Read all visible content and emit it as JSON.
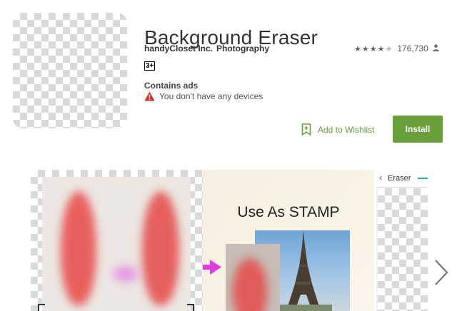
{
  "app": {
    "title": "Background Eraser",
    "developer": "handyCloset Inc.",
    "category": "Photography",
    "content_rating": "3+",
    "rating_stars": 4.5,
    "rating_count": "176,730",
    "contains_ads": "Contains ads",
    "device_warning": "You don't have any devices"
  },
  "actions": {
    "wishlist_label": "Add to Wishlist",
    "install_label": "Install"
  },
  "screenshots": {
    "stamp_title": "Use As STAMP",
    "third_header": "Eraser"
  },
  "colors": {
    "accent": "#689f38",
    "warning": "#d32f2f"
  },
  "icons": [
    "star-icon",
    "person-icon",
    "warning-icon",
    "bookmark-add-icon",
    "chevron-right-icon",
    "back-chevron-icon",
    "arrow-right-icon"
  ]
}
